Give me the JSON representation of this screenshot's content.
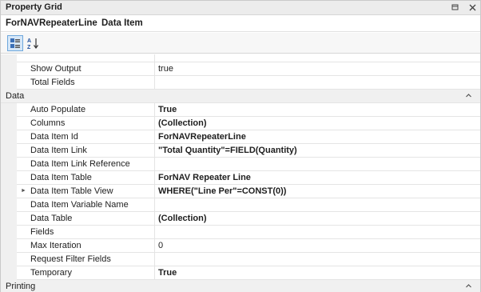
{
  "panel": {
    "title": "Property Grid",
    "pin_icon": "pin-icon",
    "close_icon": "close-icon"
  },
  "object": {
    "name": "ForNAVRepeaterLine",
    "type": "Data Item"
  },
  "toolbar": {
    "categorized_icon": "categorized-icon",
    "alphabetical_icon": "alphabetical-sort-icon"
  },
  "rows": [
    {
      "name": "Show Output",
      "value": "true",
      "bold": false
    },
    {
      "name": "Total Fields",
      "value": "",
      "bold": false
    }
  ],
  "category_data": {
    "label": "Data",
    "rows": [
      {
        "name": "Auto Populate",
        "value": "True",
        "bold": true
      },
      {
        "name": "Columns",
        "value": "(Collection)",
        "bold": true
      },
      {
        "name": "Data Item Id",
        "value": "ForNAVRepeaterLine",
        "bold": true
      },
      {
        "name": "Data Item Link",
        "value": "\"Total Quantity\"=FIELD(Quantity)",
        "bold": true
      },
      {
        "name": "Data Item Link Reference",
        "value": "",
        "bold": false
      },
      {
        "name": "Data Item Table",
        "value": "ForNAV Repeater Line",
        "bold": true
      },
      {
        "name": "Data Item Table View",
        "value": "WHERE(\"Line Per\"=CONST(0))",
        "bold": true,
        "expandable": true
      },
      {
        "name": "Data Item Variable Name",
        "value": "",
        "bold": false
      },
      {
        "name": "Data Table",
        "value": "(Collection)",
        "bold": true
      },
      {
        "name": "Fields",
        "value": "",
        "bold": false
      },
      {
        "name": "Max Iteration",
        "value": "0",
        "bold": false
      },
      {
        "name": "Request Filter Fields",
        "value": "",
        "bold": false
      },
      {
        "name": "Temporary",
        "value": "True",
        "bold": true
      }
    ]
  },
  "category_printing": {
    "label": "Printing"
  },
  "colors": {
    "category_bg": "#f0f0f0",
    "title_bg": "#ececec",
    "grid_line": "#e4e4e4"
  }
}
